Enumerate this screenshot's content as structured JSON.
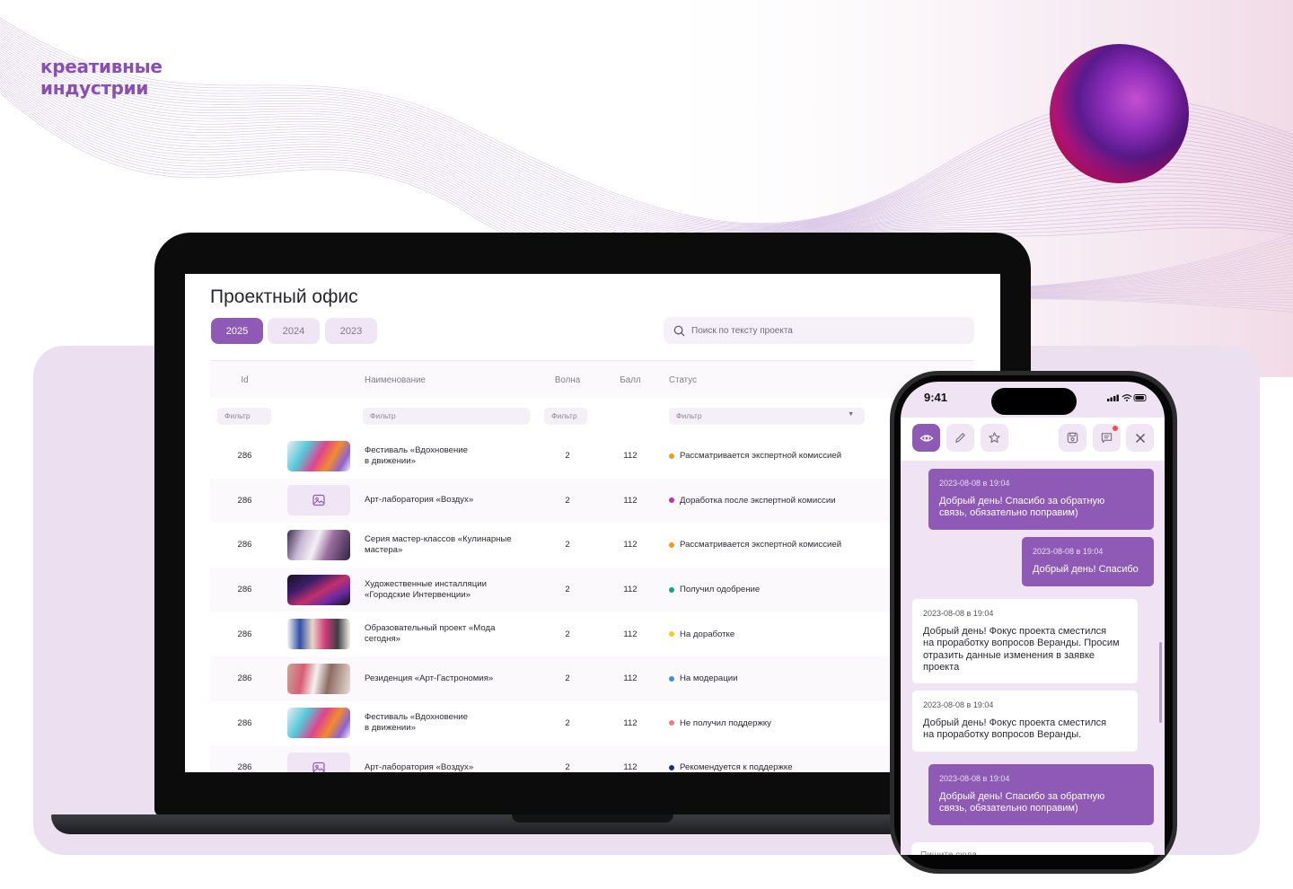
{
  "brand": {
    "line1": "креативные",
    "line2": "индустрии"
  },
  "colors": {
    "accent": "#8e5ab5",
    "accent_light": "#efe5f4",
    "stage": "#ebdff0"
  },
  "app": {
    "title": "Проектный офис",
    "tabs": [
      {
        "label": "2025",
        "active": true
      },
      {
        "label": "2024",
        "active": false
      },
      {
        "label": "2023",
        "active": false
      }
    ],
    "search_placeholder": "Поиск по тексту проекта",
    "columns": {
      "id": "Id",
      "name": "Наименование",
      "wave": "Волна",
      "score": "Балл",
      "status": "Статус"
    },
    "filter_label": "Фильтр",
    "rows": [
      {
        "id": "286",
        "image": "festival-art",
        "name1": "Фестиваль «Вдохновение",
        "name2": "в движении»",
        "wave": "2",
        "score": "112",
        "status": "Рассматривается экспертной комиссией",
        "status_color": "#f29a1c"
      },
      {
        "id": "286",
        "image": "image-placeholder-icon",
        "name1": "Арт-лаборатория «Воздух»",
        "name2": "",
        "wave": "2",
        "score": "112",
        "status": "Доработка после экспертной комиссии",
        "status_color": "#c62bb3"
      },
      {
        "id": "286",
        "image": "cooking-class",
        "name1": "Серия мастер-классов «Кулинарные",
        "name2": "мастера»",
        "wave": "2",
        "score": "112",
        "status": "Рассматривается экспертной комиссией",
        "status_color": "#f29a1c"
      },
      {
        "id": "286",
        "image": "installation",
        "name1": "Художественные инсталляции",
        "name2": "«Городские Интервенции»",
        "wave": "2",
        "score": "112",
        "status": "Получил одобрение",
        "status_color": "#1a9e86"
      },
      {
        "id": "286",
        "image": "fashion-collage",
        "name1": "Образовательный проект «Мода",
        "name2": "сегодня»",
        "wave": "2",
        "score": "112",
        "status": "На доработке",
        "status_color": "#f1cf1a"
      },
      {
        "id": "286",
        "image": "residence-gallery",
        "name1": "Резиденция «Арт-Гастрономия»",
        "name2": "",
        "wave": "2",
        "score": "112",
        "status": "На модерации",
        "status_color": "#3f8ee8"
      },
      {
        "id": "286",
        "image": "festival-art",
        "name1": "Фестиваль «Вдохновение",
        "name2": "в движении»",
        "wave": "2",
        "score": "112",
        "status": "Не получил поддержку",
        "status_color": "#f07c86"
      },
      {
        "id": "286",
        "image": "image-placeholder-icon",
        "name1": "Арт-лаборатория «Воздух»",
        "name2": "",
        "wave": "2",
        "score": "112",
        "status": "Рекомендуется к поддержке",
        "status_color": "#1b2a8f"
      }
    ]
  },
  "phone": {
    "time": "9:41",
    "messages": [
      {
        "dir": "out",
        "ts": "2023-08-08 в 19:04",
        "l1": "Добрый день! Спасибо за обратную",
        "l2": "связь, обязательно поправим)",
        "l3": "",
        "l4": ""
      },
      {
        "dir": "out",
        "ts": "2023-08-08 в 19:04",
        "l1": "Добрый день! Спасибо",
        "l2": "",
        "l3": "",
        "l4": ""
      },
      {
        "dir": "in",
        "ts": "2023-08-08 в 19:04",
        "l1": "Добрый день! Фокус проекта сместился",
        "l2": "на проработку вопросов Веранды. Просим",
        "l3": "отразить данные изменения в заявке",
        "l4": "проекта"
      },
      {
        "dir": "in",
        "ts": "2023-08-08 в 19:04",
        "l1": "Добрый день! Фокус проекта сместился",
        "l2": "на проработку вопросов Веранды.",
        "l3": "",
        "l4": ""
      },
      {
        "dir": "out",
        "ts": "2023-08-08 в 19:04",
        "l1": "Добрый день! Спасибо за обратную",
        "l2": "связь, обязательно поправим)",
        "l3": "",
        "l4": ""
      }
    ],
    "compose_placeholder": "Пишите сюда"
  }
}
